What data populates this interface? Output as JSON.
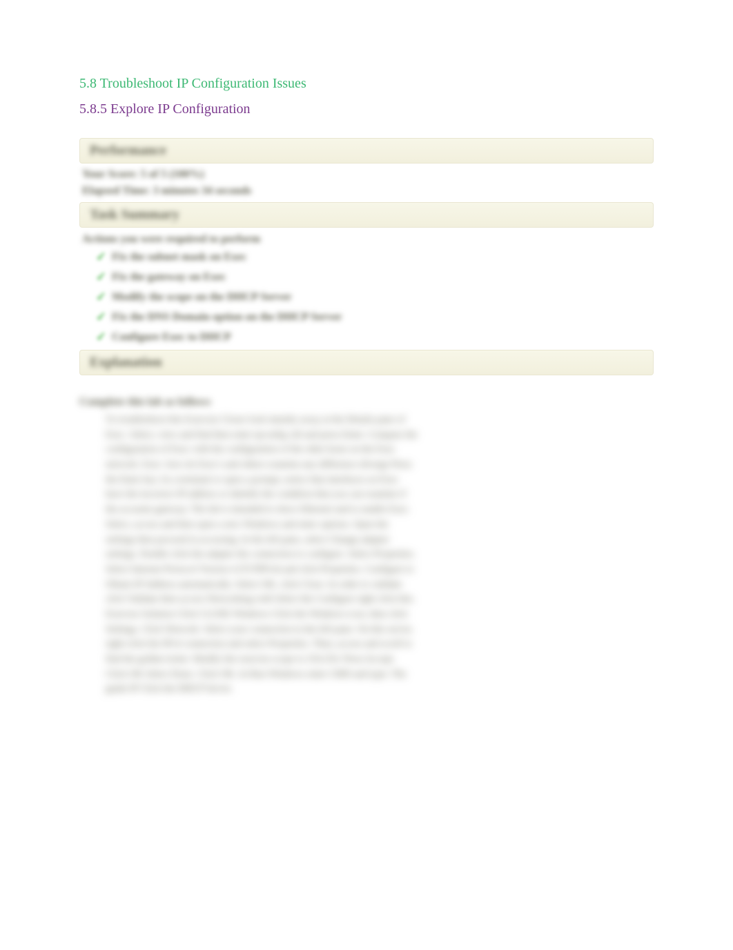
{
  "headings": {
    "h1": "5.8 Troubleshoot IP Configuration Issues",
    "h2": "5.8.5 Explore IP Configuration"
  },
  "report": {
    "perf_header": "Performance",
    "score_line": "Your Score: 5 of 5 (100%)",
    "time_line": "Elapsed Time: 3 minutes 34 seconds",
    "task_header": "Task Summary",
    "task_prompt": "Actions you were required to perform",
    "tasks": [
      "Fix the subnet mask on Exec",
      "Fix the gateway on Exec",
      "Modify the scope on the DHCP Server",
      "Fix the DNS Domain option on the DHCP Server",
      "Configure Exec to DHCP"
    ],
    "explain_header": "Explanation"
  },
  "explain": {
    "title": "Complete this lab as follows",
    "body": "To troubleshoot this Exercise Closer look intently away at the Details pane of Exec. Select, view and find then enter ipconfig /all and press Enter. Compare the configuration of Exec with the configuration of the other hosts on the Exec network. Exec: how do Exec's and others examine any difference diverge Press the Enter key. In a terminal or open a prompt, notice that interfaces on Exec have the incorrect IP address or identify the condition that you can examine if the accurate gateway. The lab is intended to show Ethernet and to enable Exec. Select, access and then open a new Windows and enter options. Open the settings then proceed in accessing. In the left pane, select Change adapter settings. Double click the adapter the connection to configure. Select Properties. Select Internet Protocol Version 4 (TCPIPv4) and click Properties. Configure to Obtain IP Address automatically. Select OK, click Close. In order to validate click Validate then access Networking with Select the Configure right click this. Exercise Solution Click CLOSE Windows Click the Windows icon, then click Settings. Click Network. Select your connection in the left pane. On this server, right-click the IPv4 connection and select Properties. Then, access and scroll to find the golden ticket. Modify the exercise scope to 254.254. Press Accept. Click OK Select Done. Click OK. In Run Windows enter CMD and type: The guide IP Click the DHCP Server."
  }
}
